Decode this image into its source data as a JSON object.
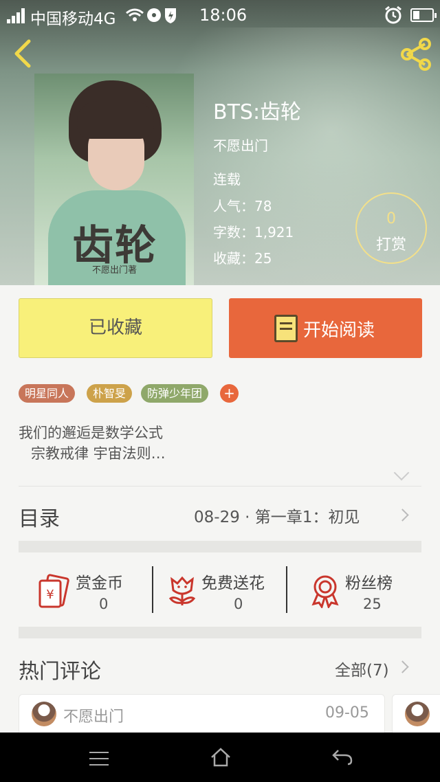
{
  "status_bar": {
    "carrier": "中国移动4G",
    "time": "18:06"
  },
  "book": {
    "title": "BTS:齿轮",
    "author": "不愿出门",
    "status": "连载",
    "popularity": "人气：78",
    "word_count": "字数：1,921",
    "favorites": "收藏：25",
    "cover_title": "齿轮",
    "cover_author": "不愿出门著"
  },
  "tip": {
    "count": "0",
    "label": "打赏"
  },
  "actions": {
    "favorited_label": "已收藏",
    "read_label": "开始阅读"
  },
  "tags": [
    {
      "label": "明星同人",
      "color": "#c8765a"
    },
    {
      "label": "朴智旻",
      "color": "#cda24a"
    },
    {
      "label": "防弹少年团",
      "color": "#8fa86a"
    }
  ],
  "tag_add": "+",
  "intro": {
    "line1": "我们的邂逅是数学公式",
    "line2": "宗教戒律 宇宙法则…"
  },
  "toc": {
    "title": "目录",
    "latest": "08-29 · 第一章1：初见"
  },
  "stats": [
    {
      "label": "赏金币",
      "value": "0",
      "icon": "red-envelope-icon"
    },
    {
      "label": "免费送花",
      "value": "0",
      "icon": "flower-icon"
    },
    {
      "label": "粉丝榜",
      "value": "25",
      "icon": "award-ribbon-icon"
    }
  ],
  "comments": {
    "title": "热门评论",
    "all_label": "全部(7)",
    "items": [
      {
        "user": "不愿出门",
        "date": "09-05"
      }
    ]
  },
  "colors": {
    "accent_orange": "#e8673c",
    "favorite_yellow": "#f8f07a",
    "icon_red": "#c9362c"
  }
}
